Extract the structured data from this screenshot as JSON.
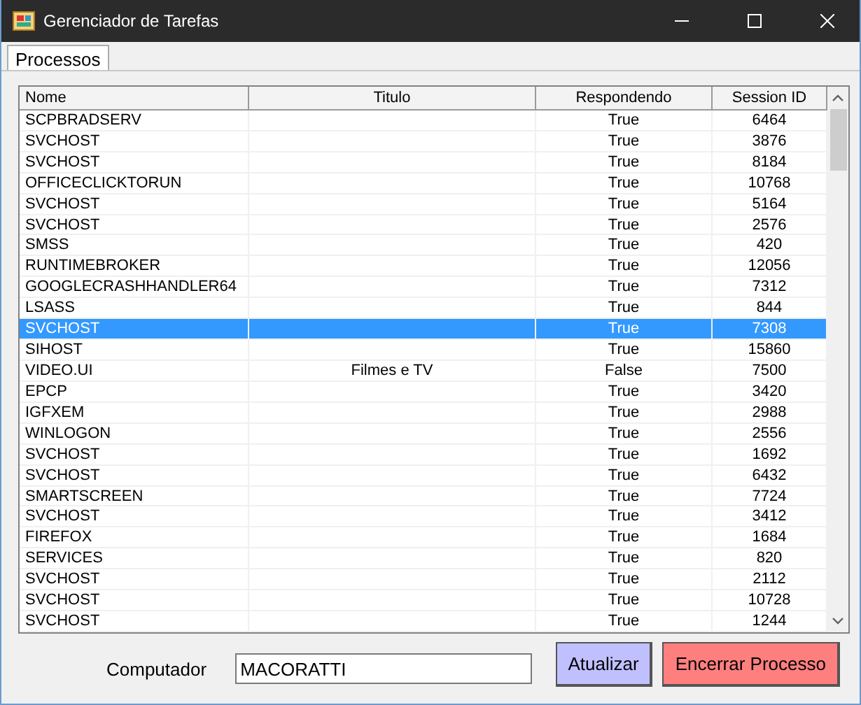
{
  "window": {
    "title": "Gerenciador de Tarefas"
  },
  "tabs": [
    {
      "label": "Processos",
      "selected": true
    }
  ],
  "table": {
    "columns": [
      "Nome",
      "Titulo",
      "Respondendo",
      "Session ID"
    ],
    "rows": [
      {
        "cells": [
          "SCPBRADSERV",
          "",
          "True",
          "6464"
        ],
        "selected": false
      },
      {
        "cells": [
          "SVCHOST",
          "",
          "True",
          "3876"
        ],
        "selected": false
      },
      {
        "cells": [
          "SVCHOST",
          "",
          "True",
          "8184"
        ],
        "selected": false
      },
      {
        "cells": [
          "OFFICECLICKTORUN",
          "",
          "True",
          "10768"
        ],
        "selected": false
      },
      {
        "cells": [
          "SVCHOST",
          "",
          "True",
          "5164"
        ],
        "selected": false
      },
      {
        "cells": [
          "SVCHOST",
          "",
          "True",
          "2576"
        ],
        "selected": false
      },
      {
        "cells": [
          "SMSS",
          "",
          "True",
          "420"
        ],
        "selected": false
      },
      {
        "cells": [
          "RUNTIMEBROKER",
          "",
          "True",
          "12056"
        ],
        "selected": false
      },
      {
        "cells": [
          "GOOGLECRASHHANDLER64",
          "",
          "True",
          "7312"
        ],
        "selected": false
      },
      {
        "cells": [
          "LSASS",
          "",
          "True",
          "844"
        ],
        "selected": false
      },
      {
        "cells": [
          "SVCHOST",
          "",
          "True",
          "7308"
        ],
        "selected": true
      },
      {
        "cells": [
          "SIHOST",
          "",
          "True",
          "15860"
        ],
        "selected": false
      },
      {
        "cells": [
          "VIDEO.UI",
          "Filmes e TV",
          "False",
          "7500"
        ],
        "selected": false
      },
      {
        "cells": [
          "EPCP",
          "",
          "True",
          "3420"
        ],
        "selected": false
      },
      {
        "cells": [
          "IGFXEM",
          "",
          "True",
          "2988"
        ],
        "selected": false
      },
      {
        "cells": [
          "WINLOGON",
          "",
          "True",
          "2556"
        ],
        "selected": false
      },
      {
        "cells": [
          "SVCHOST",
          "",
          "True",
          "1692"
        ],
        "selected": false
      },
      {
        "cells": [
          "SVCHOST",
          "",
          "True",
          "6432"
        ],
        "selected": false
      },
      {
        "cells": [
          "SMARTSCREEN",
          "",
          "True",
          "7724"
        ],
        "selected": false
      },
      {
        "cells": [
          "SVCHOST",
          "",
          "True",
          "3412"
        ],
        "selected": false
      },
      {
        "cells": [
          "FIREFOX",
          "",
          "True",
          "1684"
        ],
        "selected": false
      },
      {
        "cells": [
          "SERVICES",
          "",
          "True",
          "820"
        ],
        "selected": false
      },
      {
        "cells": [
          "SVCHOST",
          "",
          "True",
          "2112"
        ],
        "selected": false
      },
      {
        "cells": [
          "SVCHOST",
          "",
          "True",
          "10728"
        ],
        "selected": false
      },
      {
        "cells": [
          "SVCHOST",
          "",
          "True",
          "1244"
        ],
        "selected": false
      }
    ]
  },
  "computer": {
    "label": "Computador",
    "value": "MACORATTI"
  },
  "buttons": [
    {
      "label": "Atualizar",
      "kind": "refresh"
    },
    {
      "label": "Encerrar Processo",
      "kind": "kill"
    }
  ]
}
